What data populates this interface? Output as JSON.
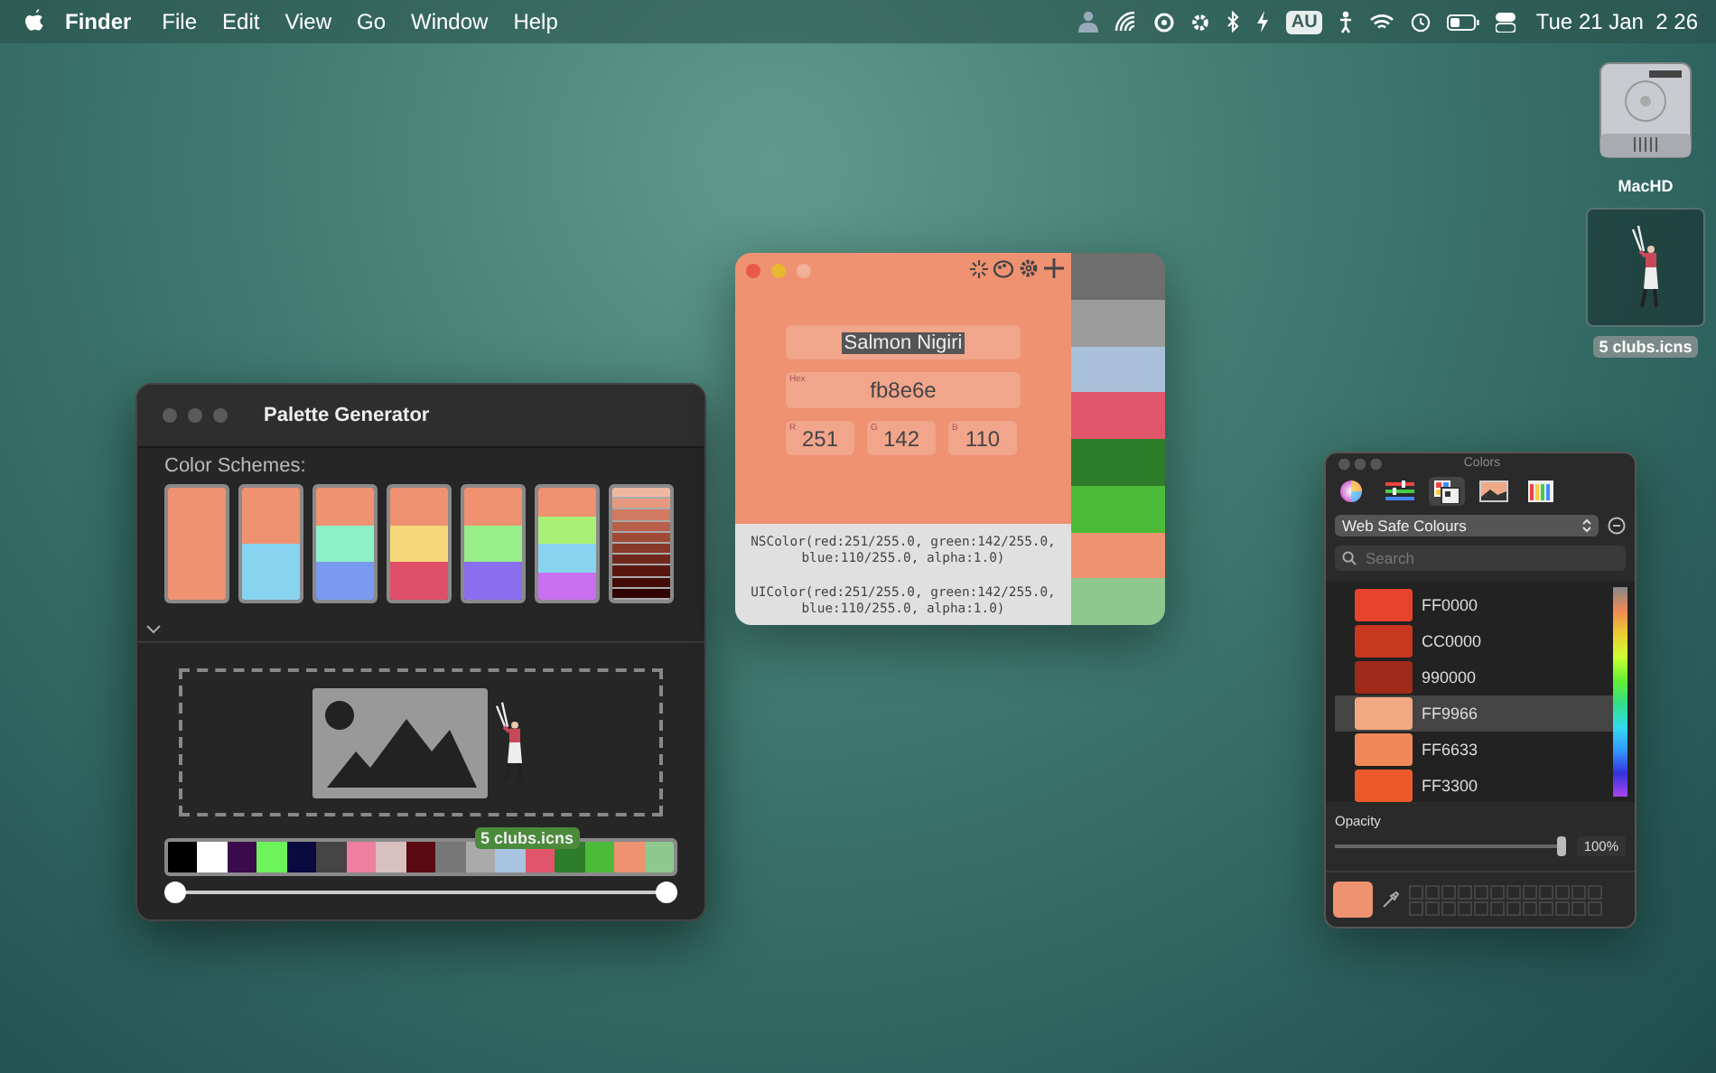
{
  "menu_bar": {
    "app_name": "Finder",
    "menus": [
      "File",
      "Edit",
      "View",
      "Go",
      "Window",
      "Help"
    ],
    "input_source": "AU",
    "clock": "Tue 21 Jan  2 26"
  },
  "desktop_icons": [
    {
      "kind": "drive",
      "label": "MacHD",
      "selected": false
    },
    {
      "kind": "figure",
      "label": "5 clubs.icns",
      "selected": true
    }
  ],
  "palette_generator": {
    "title": "Palette Generator",
    "section_label": "Color Schemes:",
    "schemes": [
      {
        "colors": [
          {
            "color": "#ee9272"
          }
        ]
      },
      {
        "colors": [
          {
            "color": "#ee9272"
          },
          {
            "color": "#88d4f0"
          }
        ]
      },
      {
        "colors": [
          {
            "color": "#ee9272"
          },
          {
            "color": "#8ef0c8"
          },
          {
            "color": "#7a9af0"
          }
        ]
      },
      {
        "colors": [
          {
            "color": "#ee9272"
          },
          {
            "color": "#f5d878"
          },
          {
            "color": "#e04f6a"
          }
        ]
      },
      {
        "colors": [
          {
            "color": "#ee9272"
          },
          {
            "color": "#98ee88"
          },
          {
            "color": "#8a6ef0"
          }
        ]
      },
      {
        "colors": [
          {
            "color": "#ee9272"
          },
          {
            "color": "#a8f078"
          },
          {
            "color": "#88d4f0"
          },
          {
            "color": "#c870f0"
          }
        ]
      },
      {
        "colors": [
          {
            "color": "#f0b8a0"
          },
          {
            "color": "#e89a80"
          },
          {
            "color": "#d07a62"
          },
          {
            "color": "#b8604a"
          },
          {
            "color": "#a04a38"
          },
          {
            "color": "#883828"
          },
          {
            "color": "#70281c"
          },
          {
            "color": "#581810"
          },
          {
            "color": "#440c08"
          },
          {
            "color": "#300404"
          }
        ]
      }
    ],
    "drag_label": "5 clubs.icns",
    "palette": [
      {
        "color": "#000000"
      },
      {
        "color": "#ffffff"
      },
      {
        "color": "#3a0a4a"
      },
      {
        "color": "#6cf25a"
      },
      {
        "color": "#0a0a40"
      },
      {
        "color": "#444444"
      },
      {
        "color": "#ee7fa0"
      },
      {
        "color": "#d8c0c0"
      },
      {
        "color": "#5a0a10"
      },
      {
        "color": "#777777"
      },
      {
        "color": "#aaaaaa"
      },
      {
        "color": "#a8c4e0"
      },
      {
        "color": "#e0556a"
      },
      {
        "color": "#2e7d2a"
      },
      {
        "color": "#4cbb3a"
      },
      {
        "color": "#ee9272"
      },
      {
        "color": "#8ec88e"
      }
    ],
    "range_thumbs": [
      {
        "level": 0
      },
      {
        "level": 1
      }
    ]
  },
  "color_window": {
    "name": "Salmon Nigiri",
    "hex_label": "Hex",
    "hex": "fb8e6e",
    "channels": [
      {
        "label": "R",
        "value": "251"
      },
      {
        "label": "G",
        "value": "142"
      },
      {
        "label": "B",
        "value": "110"
      }
    ],
    "code_snippets": [
      "NSColor(red:251/255.0, green:142/255.0, blue:110/255.0, alpha:1.0)",
      "UIColor(red:251/255.0, green:142/255.0, blue:110/255.0, alpha:1.0)"
    ],
    "history": [
      {
        "color": "#6e6e6e"
      },
      {
        "color": "#9c9c9c"
      },
      {
        "color": "#a8c0d8"
      },
      {
        "color": "#e0556a"
      },
      {
        "color": "#2e7d2a"
      },
      {
        "color": "#4cbb3a"
      },
      {
        "color": "#ee9272"
      },
      {
        "color": "#8ec88e"
      }
    ]
  },
  "colors_panel": {
    "title": "Colors",
    "tabs": [
      {
        "kind": "wheel",
        "selected": false
      },
      {
        "kind": "sliders",
        "selected": false
      },
      {
        "kind": "palettes",
        "selected": true
      },
      {
        "kind": "image",
        "selected": false
      },
      {
        "kind": "pencils",
        "selected": false
      }
    ],
    "palette_menu": "Web Safe Colours",
    "search_placeholder": "Search",
    "colors": [
      {
        "label": "FF0000",
        "color": "#e8442c",
        "selected": false
      },
      {
        "label": "CC0000",
        "color": "#c8381e",
        "selected": false
      },
      {
        "label": "990000",
        "color": "#a02a18",
        "selected": false
      },
      {
        "label": "FF9966",
        "color": "#f2a880",
        "selected": true
      },
      {
        "label": "FF6633",
        "color": "#f08858",
        "selected": false
      },
      {
        "label": "FF3300",
        "color": "#ec5a2c",
        "selected": false
      }
    ],
    "opacity_label": "Opacity",
    "opacity": {
      "level": 1
    },
    "opacity_reading": "100%"
  }
}
